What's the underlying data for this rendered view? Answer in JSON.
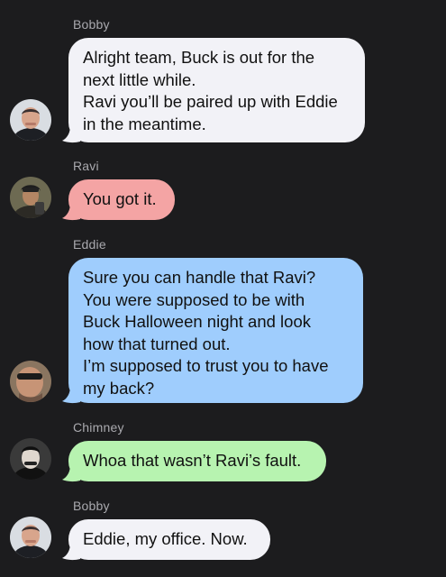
{
  "messages": [
    {
      "sender": "Bobby",
      "lines": [
        "Alright team, Buck is out for the",
        "next little while.",
        "Ravi you’ll be paired up with Eddie",
        "in the meantime."
      ],
      "color": "#f2f2f7",
      "avatar": "bobby-avatar-icon"
    },
    {
      "sender": "Ravi",
      "lines": [
        "You got it."
      ],
      "color": "#f4a4a4",
      "avatar": "ravi-avatar-icon"
    },
    {
      "sender": "Eddie",
      "lines": [
        "Sure you can handle that Ravi?",
        "You were supposed to be with",
        "Buck Halloween night and look",
        "how that turned out.",
        "I’m supposed to trust you to have",
        "my back?"
      ],
      "color": "#9fcdfd",
      "avatar": "eddie-avatar-icon"
    },
    {
      "sender": "Chimney",
      "lines": [
        "Whoa that wasn’t Ravi’s fault."
      ],
      "color": "#b7f3b0",
      "avatar": "chimney-avatar-icon"
    },
    {
      "sender": "Bobby",
      "lines": [
        "Eddie, my office. Now."
      ],
      "color": "#f2f2f7",
      "avatar": "bobby-avatar-icon"
    }
  ]
}
